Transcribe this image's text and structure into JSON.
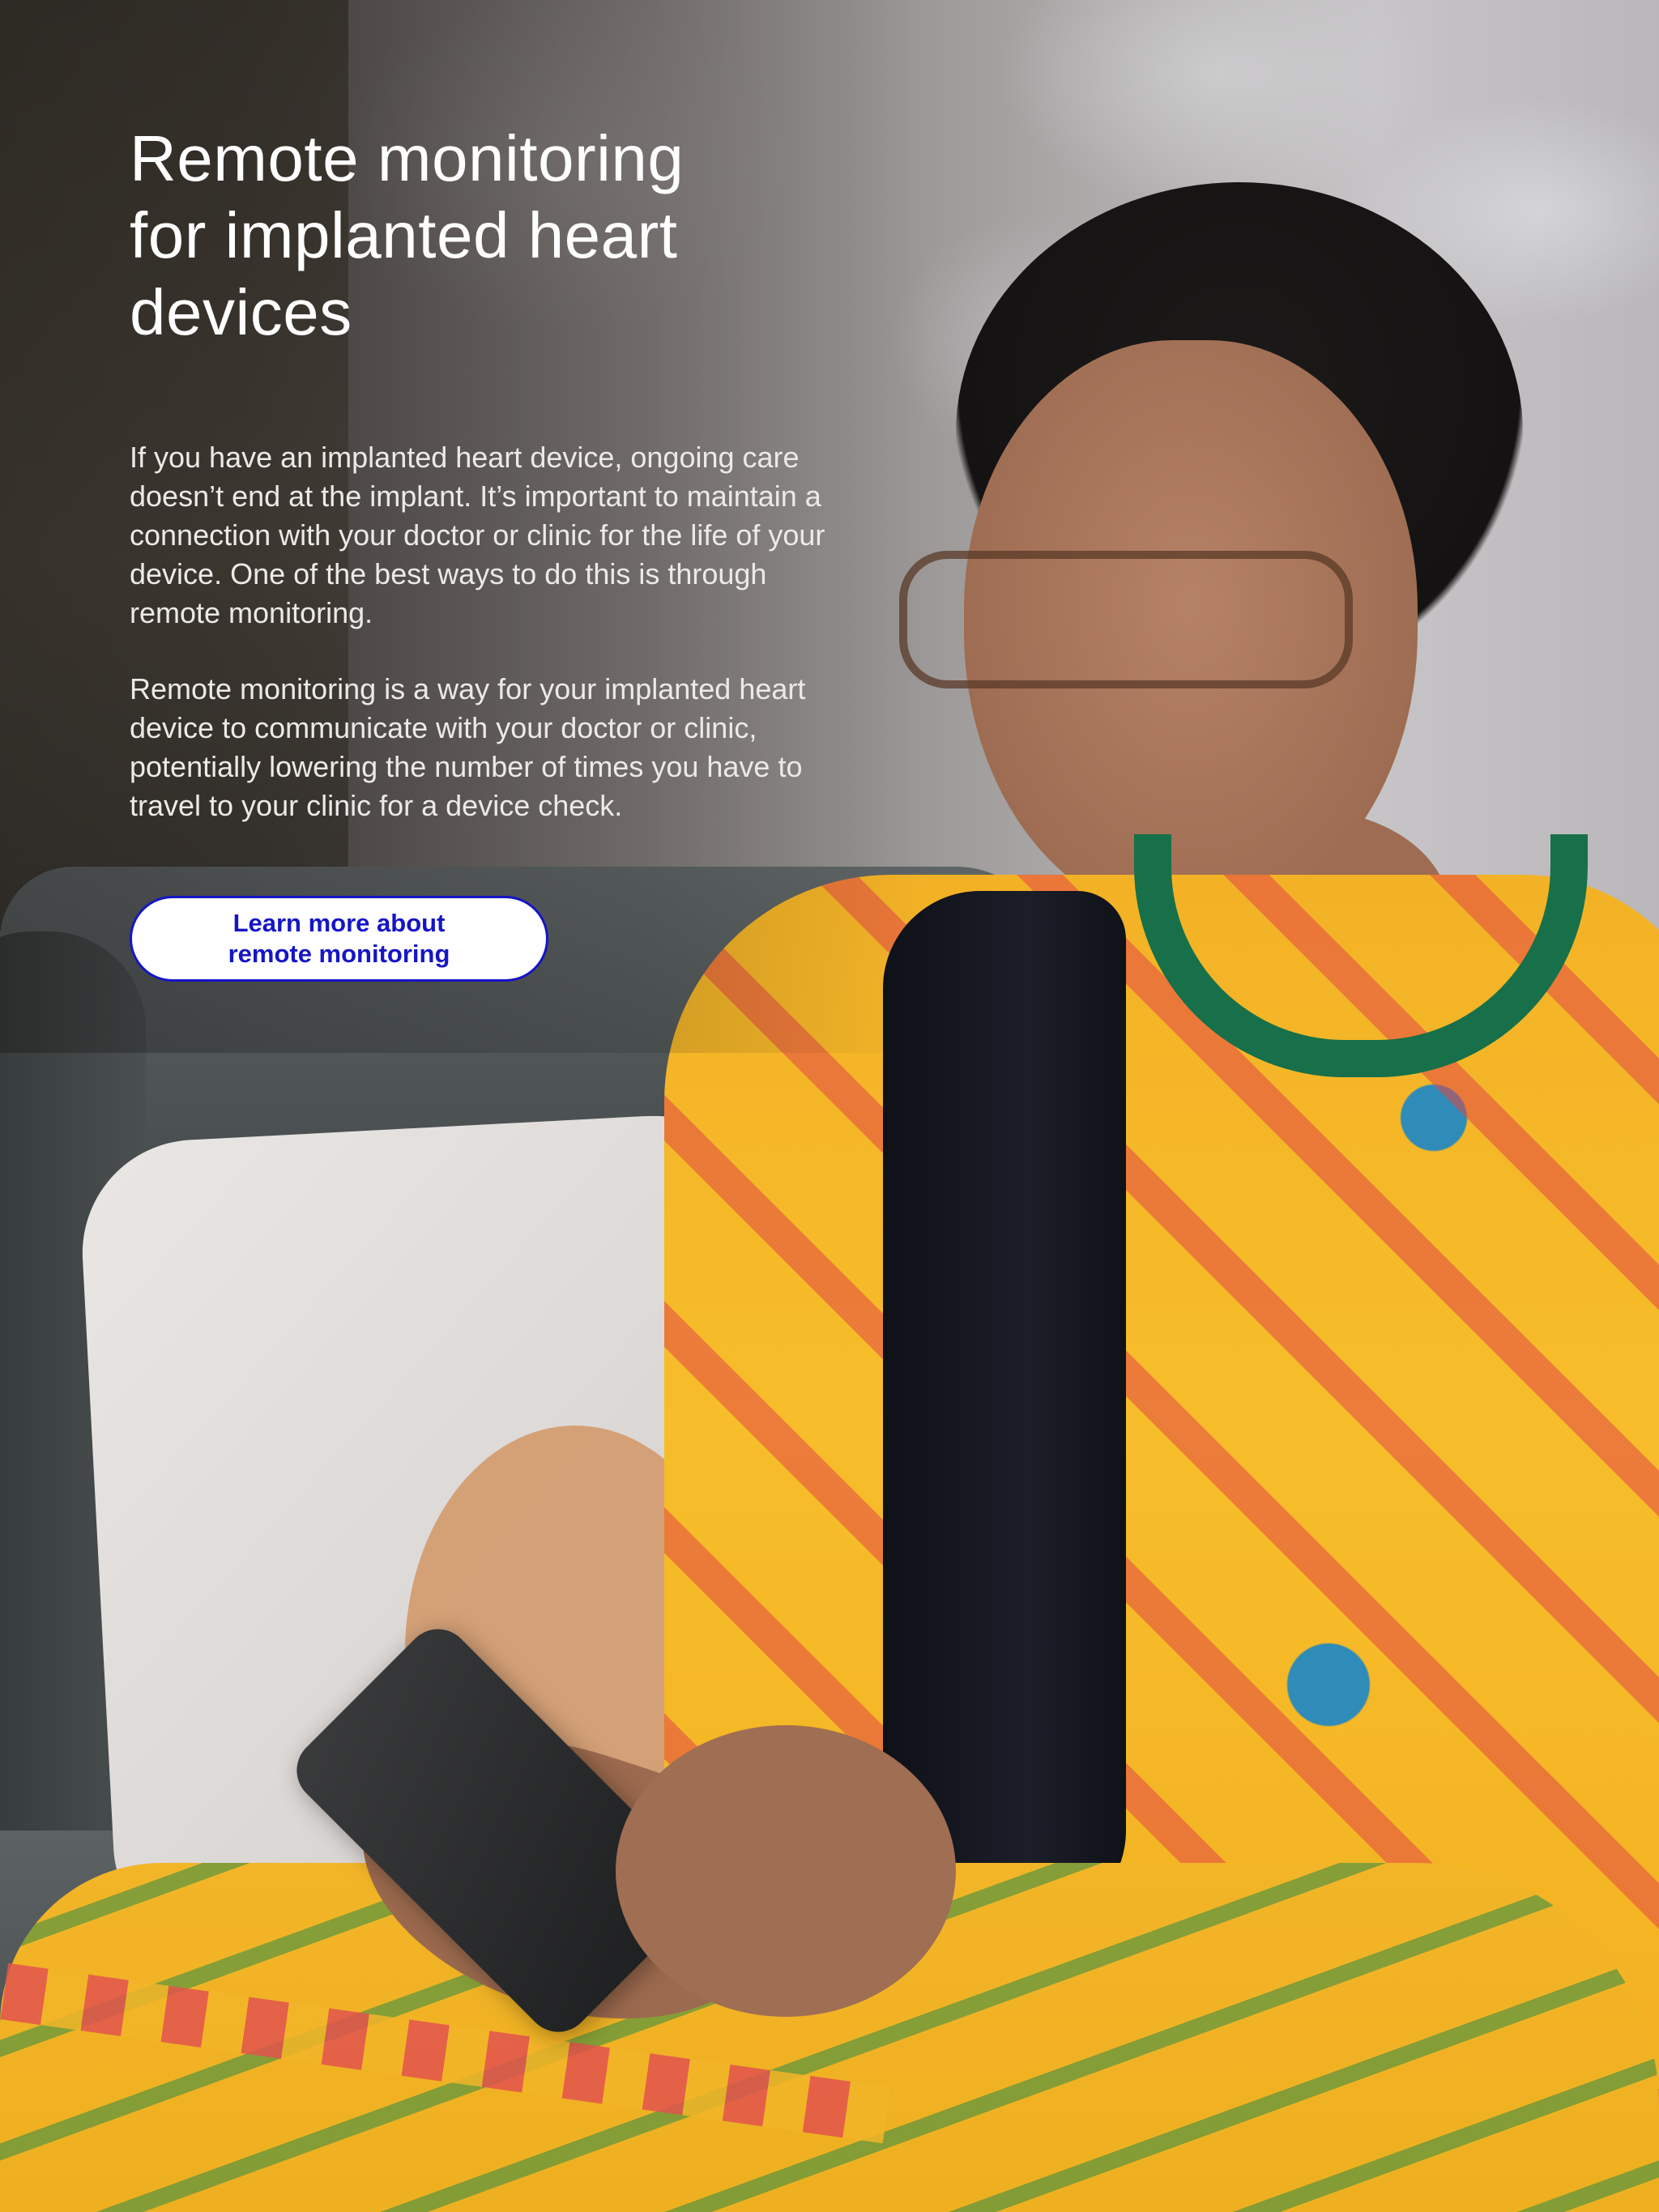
{
  "hero": {
    "headline": "Remote monitoring for implanted heart devices",
    "paragraphs": [
      "If you have an implanted heart device, ongoing care doesn’t end at the implant. It’s important to maintain a connection with your doctor or clinic for the life of your device. One of the best ways to do this is through remote monitoring.",
      "Remote monitoring is a way for your implanted heart device to communicate with your doctor or clinic, potentially lowering the number of times you have to travel to your clinic for a device check."
    ],
    "cta_label": "Learn more about\nremote monitoring"
  },
  "colors": {
    "cta_text": "#1515c6",
    "cta_border": "#1515c6",
    "cta_background": "#ffffff",
    "headline_text": "#ffffff"
  }
}
